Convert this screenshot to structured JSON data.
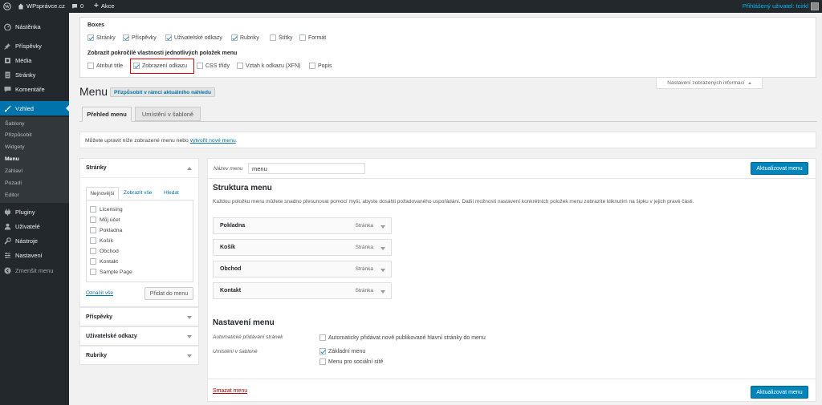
{
  "adminbar": {
    "site_name": "WPsprávce.cz",
    "comments_count": "0",
    "new_label": "Akce",
    "logged_in": "Přihlášený uživatel: tcirkl"
  },
  "sidebar": {
    "items": [
      {
        "label": "Nástěnka",
        "icon": "dashboard-icon"
      },
      {
        "label": "Příspěvky",
        "icon": "pin-icon"
      },
      {
        "label": "Média",
        "icon": "media-icon"
      },
      {
        "label": "Stránky",
        "icon": "page-icon"
      },
      {
        "label": "Komentáře",
        "icon": "comment-icon"
      },
      {
        "label": "Vzhled",
        "icon": "brush-icon"
      },
      {
        "label": "Pluginy",
        "icon": "plugin-icon"
      },
      {
        "label": "Uživatelé",
        "icon": "user-icon"
      },
      {
        "label": "Nástroje",
        "icon": "wrench-icon"
      },
      {
        "label": "Nastavení",
        "icon": "settings-icon"
      },
      {
        "label": "Zmenšit menu",
        "icon": "collapse-icon"
      }
    ],
    "submenu": [
      "Šablony",
      "Přizpůsobit",
      "Widgety",
      "Menu",
      "Záhlaví",
      "Pozadí",
      "Editor"
    ]
  },
  "screen_options": {
    "boxes_title": "Boxes",
    "boxes": [
      {
        "label": "Stránky",
        "checked": true
      },
      {
        "label": "Příspěvky",
        "checked": true
      },
      {
        "label": "Uživatelské odkazy",
        "checked": true
      },
      {
        "label": "Rubriky",
        "checked": true
      },
      {
        "label": "Štítky",
        "checked": false
      },
      {
        "label": "Formát",
        "checked": false
      }
    ],
    "advanced_title": "Zobrazit pokročilé vlastnosti jednotlivých položek menu",
    "advanced": [
      {
        "label": "Atribut title",
        "checked": false
      },
      {
        "label": "Zobrazení odkazu",
        "checked": true
      },
      {
        "label": "CSS třídy",
        "checked": false
      },
      {
        "label": "Vztah k odkazu (XFN)",
        "checked": false
      },
      {
        "label": "Popis",
        "checked": false
      }
    ],
    "toggle_label": "Nastavení zobrazených informací",
    "highlight_color": "#e00000"
  },
  "page": {
    "title": "Menu",
    "customize_button": "Přizpůsobit v rámci aktuálního náhledu",
    "tabs": [
      "Přehled menu",
      "Umístění v šabloně"
    ],
    "notice_text": "Můžete upravit níže zobrazené menu nebo ",
    "notice_link": "vytvořit nové menu",
    "notice_end": "."
  },
  "left": {
    "pages_title": "Stránky",
    "tabs": [
      "Nejnovější",
      "Zobrazit vše",
      "Hledat"
    ],
    "pages": [
      "Licensing",
      "Můj účet",
      "Pokladna",
      "Košík",
      "Obchod",
      "Kontakt",
      "Sample Page"
    ],
    "select_all": "Označit vše",
    "add_button": "Přidat do menu",
    "sections": [
      "Příspěvky",
      "Uživatelské odkazy",
      "Rubriky"
    ]
  },
  "right": {
    "name_label": "Název menu",
    "name_value": "menu",
    "save_button": "Aktualizovat menu",
    "structure_title": "Struktura menu",
    "structure_desc": "Každou položku menu můžete snadno přesunovat pomocí myši, abyste dosáhli požadovaného uspořádání. Další možnosti nastavení konkrétních položek menu zobrazíte kliknutím na šipku v jejich pravé části.",
    "items": [
      {
        "title": "Pokladna",
        "type": "Stránka"
      },
      {
        "title": "Košík",
        "type": "Stránka"
      },
      {
        "title": "Obchod",
        "type": "Stránka"
      },
      {
        "title": "Kontakt",
        "type": "Stránka"
      }
    ],
    "settings_title": "Nastavení menu",
    "auto_add_label": "Automatické přidávání stránek",
    "auto_add_option": "Automaticky přidávat nově publikované hlavní stránky do menu",
    "location_label": "Umístění v šabloně",
    "locations": [
      {
        "label": "Základní menu",
        "checked": true
      },
      {
        "label": "Menu pro sociální sítě",
        "checked": false
      }
    ],
    "delete_link": "Smazat menu"
  },
  "colors": {
    "accent": "#0073aa",
    "button": "#0085ba",
    "sidebar": "#23282d"
  }
}
